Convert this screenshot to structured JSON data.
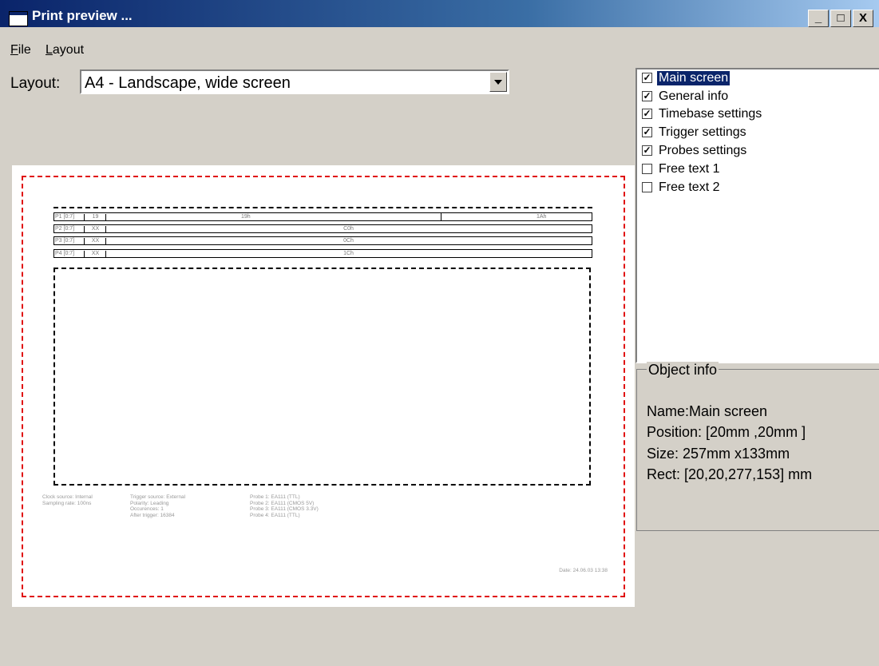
{
  "window": {
    "title": "Print preview ...",
    "buttons": [
      "_",
      "□",
      "X"
    ]
  },
  "menu": {
    "items": [
      {
        "label": "File",
        "accel": "F",
        "rest": "ile"
      },
      {
        "label": "Layout",
        "accel": "L",
        "rest": "ayout"
      }
    ]
  },
  "layout_selector": {
    "label": "Layout:",
    "value": "A4 - Landscape, wide screen"
  },
  "preview": {
    "probes": [
      {
        "label": "P1 [0:7]",
        "value": "19",
        "waveforms": [
          "19h",
          "1Ah"
        ]
      },
      {
        "label": "P2 [0:7]",
        "value": "XX",
        "waveforms": [
          "C0h"
        ]
      },
      {
        "label": "P3 [0:7]",
        "value": "XX",
        "waveforms": [
          "0Ch"
        ]
      },
      {
        "label": "P4 [0:7]",
        "value": "XX",
        "waveforms": [
          "1Ch"
        ]
      }
    ],
    "timebase": [
      "Clock source: Internal",
      "Sampling rate: 100ns"
    ],
    "trigger": [
      "Trigger source: External",
      "Polarity: Leading",
      "Occurences: 1",
      "After trigger: 16384"
    ],
    "probe_info": [
      "Probe 1: EA111 (TTL)",
      "Probe 2: EA111 (CMOS 5V)",
      "Probe 3: EA111 (CMOS 3.3V)",
      "Probe 4: EA111 (TTL)"
    ],
    "date": "Date: 24.06.03 13:38"
  },
  "objects_list": {
    "items": [
      {
        "label": "Main screen",
        "checked": true,
        "selected": true
      },
      {
        "label": "General info",
        "checked": true,
        "selected": false
      },
      {
        "label": "Timebase settings",
        "checked": true,
        "selected": false
      },
      {
        "label": "Trigger settings",
        "checked": true,
        "selected": false
      },
      {
        "label": "Probes settings",
        "checked": true,
        "selected": false
      },
      {
        "label": "Free text 1",
        "checked": false,
        "selected": false
      },
      {
        "label": "Free text 2",
        "checked": false,
        "selected": false
      }
    ]
  },
  "object_info": {
    "legend": "Object info",
    "name": "Name:Main screen",
    "position": "Position:  [20mm ,20mm ]",
    "size": "Size:   257mm x133mm",
    "rect": "Rect:  [20,20,277,153] mm"
  }
}
